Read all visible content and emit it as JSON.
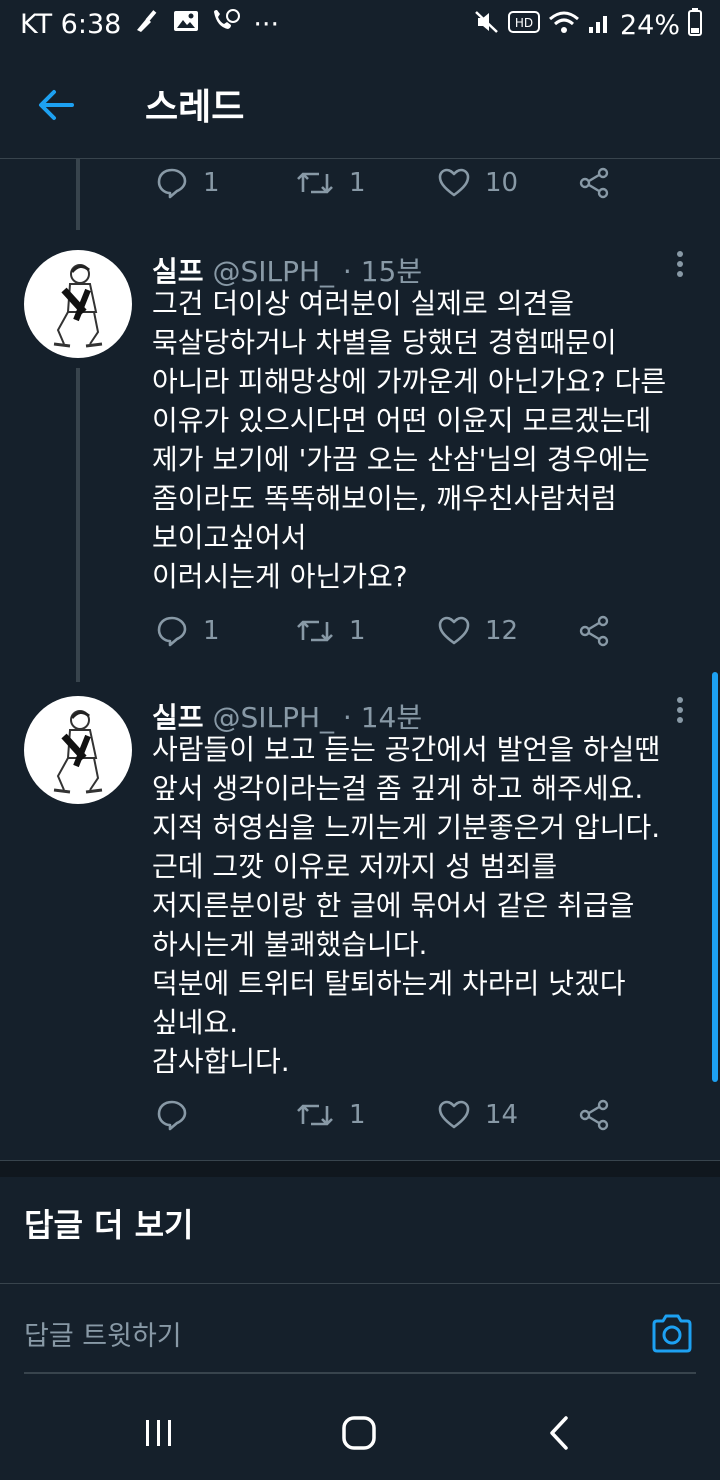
{
  "status_bar": {
    "carrier_time": "KT 6:38",
    "more_dots": "···",
    "hd_label": "HD",
    "battery": "24%"
  },
  "header": {
    "title": "스레드"
  },
  "tweets": [
    {
      "name": "실프",
      "handle": "@SILPH_",
      "time": "· 15분",
      "text": "그건 더이상 여러분이 실제로 의견을\n묵살당하거나 차별을 당했던 경험때문이\n아니라 피해망상에 가까운게 아닌가요? 다른\n이유가 있으시다면 어떤 이윤지 모르겠는데\n제가 보기에 '가끔 오는 산삼'님의 경우에는\n좀이라도 똑똑해보이는, 깨우친사람처럼\n보이고싶어서\n이러시는게 아닌가요?",
      "replies": "1",
      "retweets": "1",
      "likes": "12"
    },
    {
      "name": "실프",
      "handle": "@SILPH_",
      "time": "· 14분",
      "text": "사람들이 보고 듣는 공간에서 발언을 하실땐\n앞서 생각이라는걸 좀 깊게 하고 해주세요.\n지적 허영심을 느끼는게 기분좋은거 압니다.\n근데 그깟 이유로 저까지 성 범죄를\n저지른분이랑 한 글에 묶어서 같은 취급을\n하시는게 불쾌했습니다.\n덕분에 트위터 탈퇴하는게 차라리 낫겠다\n싶네요.\n감사합니다.",
      "replies": "",
      "retweets": "1",
      "likes": "14"
    }
  ],
  "previous_tweet_actions": {
    "replies": "1",
    "retweets": "1",
    "likes": "10"
  },
  "more_replies_label": "답글 더 보기",
  "reply_input": {
    "placeholder": "답글 트윗하기"
  },
  "colors": {
    "background": "#15202b",
    "accent": "#1da1f2",
    "muted": "#8899a6",
    "divider": "#38444d"
  }
}
